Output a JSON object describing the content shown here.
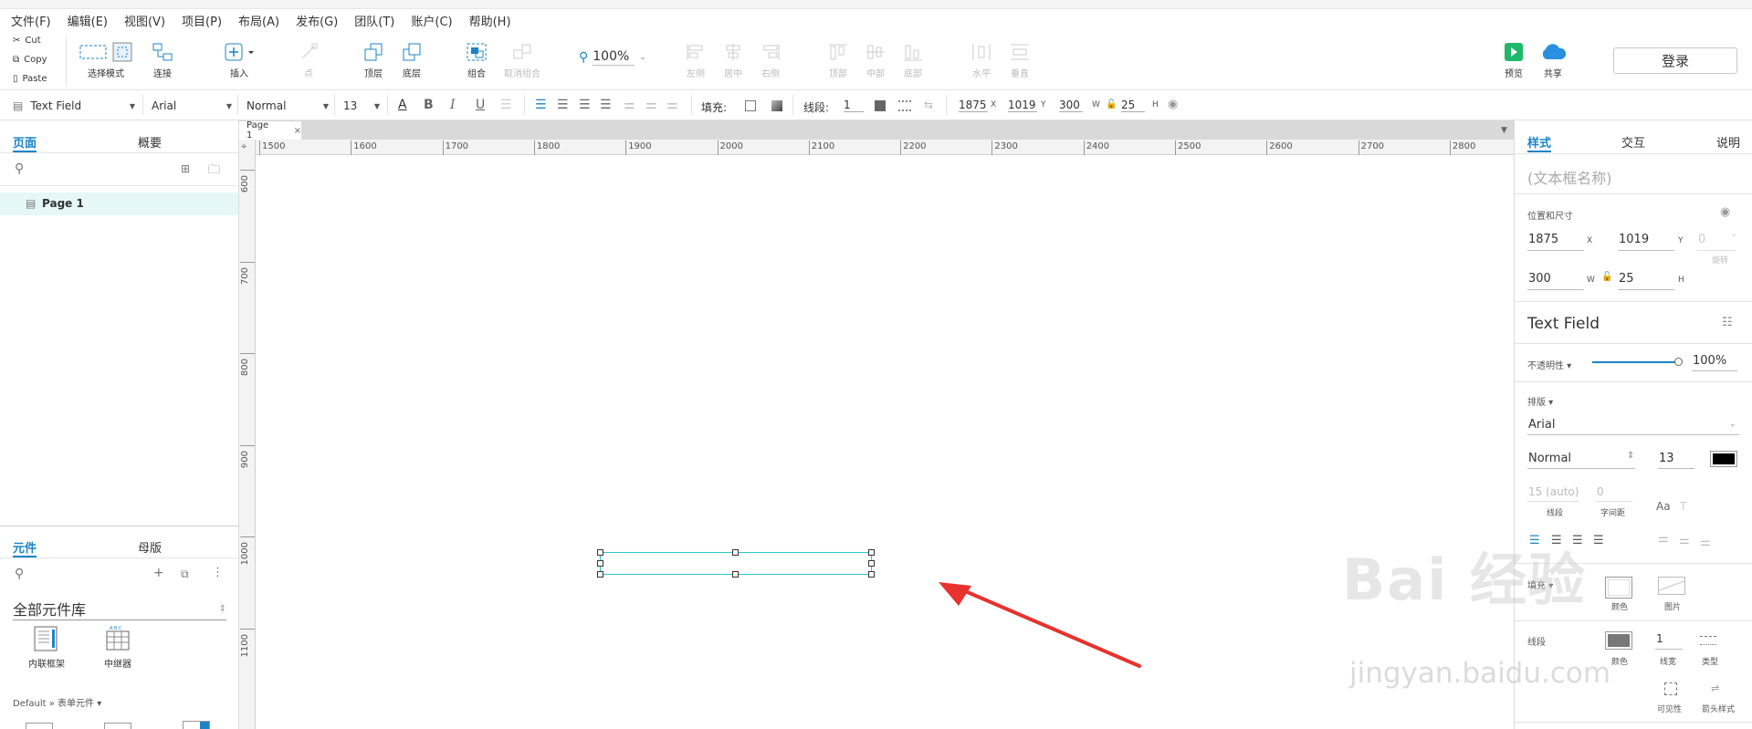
{
  "menu": [
    "文件(F)",
    "编辑(E)",
    "视图(V)",
    "项目(P)",
    "布局(A)",
    "发布(G)",
    "团队(T)",
    "账户(C)",
    "帮助(H)"
  ],
  "clipboard": {
    "cut": "Cut",
    "copy": "Copy",
    "paste": "Paste"
  },
  "toolbar": {
    "select_mode": "选择模式",
    "connect": "连接",
    "insert": "插入",
    "point": "点",
    "top_layer": "顶层",
    "bottom_layer": "底层",
    "group": "组合",
    "ungroup": "取消组合",
    "zoom": "100%",
    "align_left": "左侧",
    "align_center": "居中",
    "align_right": "右侧",
    "align_top": "顶部",
    "align_middle": "中部",
    "align_bottom": "底部",
    "dist_h": "水平",
    "dist_v": "垂直",
    "preview": "预览",
    "share": "共享",
    "login": "登录"
  },
  "format": {
    "widget_type": "Text Field",
    "font": "Arial",
    "weight": "Normal",
    "size": "13",
    "fill_label": "填充:",
    "line_label": "线段:",
    "line_width": "1",
    "x": "1875",
    "y": "1019",
    "w": "300",
    "h": "25",
    "x_lbl": "X",
    "y_lbl": "Y",
    "w_lbl": "W",
    "h_lbl": "H"
  },
  "left": {
    "tab_pages": "页面",
    "tab_outline": "概要",
    "page_item": "Page 1",
    "tab_widgets": "元件",
    "tab_masters": "母版",
    "library": "全部元件库",
    "widgets": [
      {
        "label": "内联框架"
      },
      {
        "label": "中继器"
      }
    ],
    "section": "Default » 表单元件 ▾"
  },
  "canvas": {
    "tab_name": "Page 1",
    "h_ticks": [
      "1500",
      "1600",
      "1700",
      "1800",
      "1900",
      "2000",
      "2100",
      "2200",
      "2300",
      "2400",
      "2500",
      "2600",
      "2700",
      "2800"
    ],
    "v_ticks": [
      "600",
      "700",
      "800",
      "900",
      "1000",
      "1100"
    ]
  },
  "right": {
    "tab_style": "样式",
    "tab_interact": "交互",
    "tab_notes": "说明",
    "name_placeholder": "(文本框名称)",
    "pos_size": "位置和尺寸",
    "x": "1875",
    "y": "1019",
    "rotation": "0",
    "rotation_lbl": "旋转",
    "w": "300",
    "h": "25",
    "x_lbl": "X",
    "y_lbl": "Y",
    "w_lbl": "W",
    "h_lbl": "H",
    "widget_title": "Text Field",
    "opacity_lbl": "不透明性 ▾",
    "opacity": "100%",
    "typography_lbl": "排版 ▾",
    "font": "Arial",
    "weight": "Normal",
    "size": "13",
    "line_spacing": "15 (auto)",
    "line_spacing_lbl": "线段",
    "char_spacing": "0",
    "char_spacing_lbl": "字间距",
    "fill_lbl": "填充 ▾",
    "fill_color_lbl": "颜色",
    "fill_image_lbl": "图片",
    "border_lbl": "线段",
    "border_color_lbl": "颜色",
    "border_width": "1",
    "border_width_lbl": "线宽",
    "border_type_lbl": "类型",
    "visibility_lbl": "可见性",
    "arrow_lbl": "箭头样式"
  },
  "watermark": {
    "line1": "Bai 经验",
    "line2": "jingyan.baidu.com"
  },
  "colors": {
    "accent": "#1c84c6",
    "selection": "#2ec6c6",
    "arrow": "#e8322d",
    "preview": "#1fb86a",
    "share": "#2a8fe0"
  }
}
